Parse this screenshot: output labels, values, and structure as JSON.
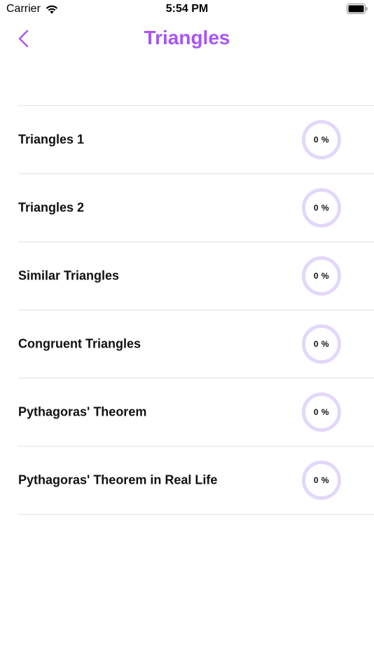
{
  "status_bar": {
    "carrier": "Carrier",
    "time": "5:54 PM"
  },
  "nav": {
    "title": "Triangles",
    "back_icon": "chevron-left-icon"
  },
  "colors": {
    "accent": "#a855f7",
    "ring": "#e3d7fb",
    "divider": "#e3e3e6"
  },
  "lessons": [
    {
      "title": "Triangles 1",
      "progress_label": "0 %",
      "progress": 0
    },
    {
      "title": "Triangles 2",
      "progress_label": "0 %",
      "progress": 0
    },
    {
      "title": "Similar Triangles",
      "progress_label": "0 %",
      "progress": 0
    },
    {
      "title": "Congruent Triangles",
      "progress_label": "0 %",
      "progress": 0
    },
    {
      "title": "Pythagoras' Theorem",
      "progress_label": "0 %",
      "progress": 0
    },
    {
      "title": "Pythagoras' Theorem in Real Life",
      "progress_label": "0 %",
      "progress": 0
    }
  ]
}
